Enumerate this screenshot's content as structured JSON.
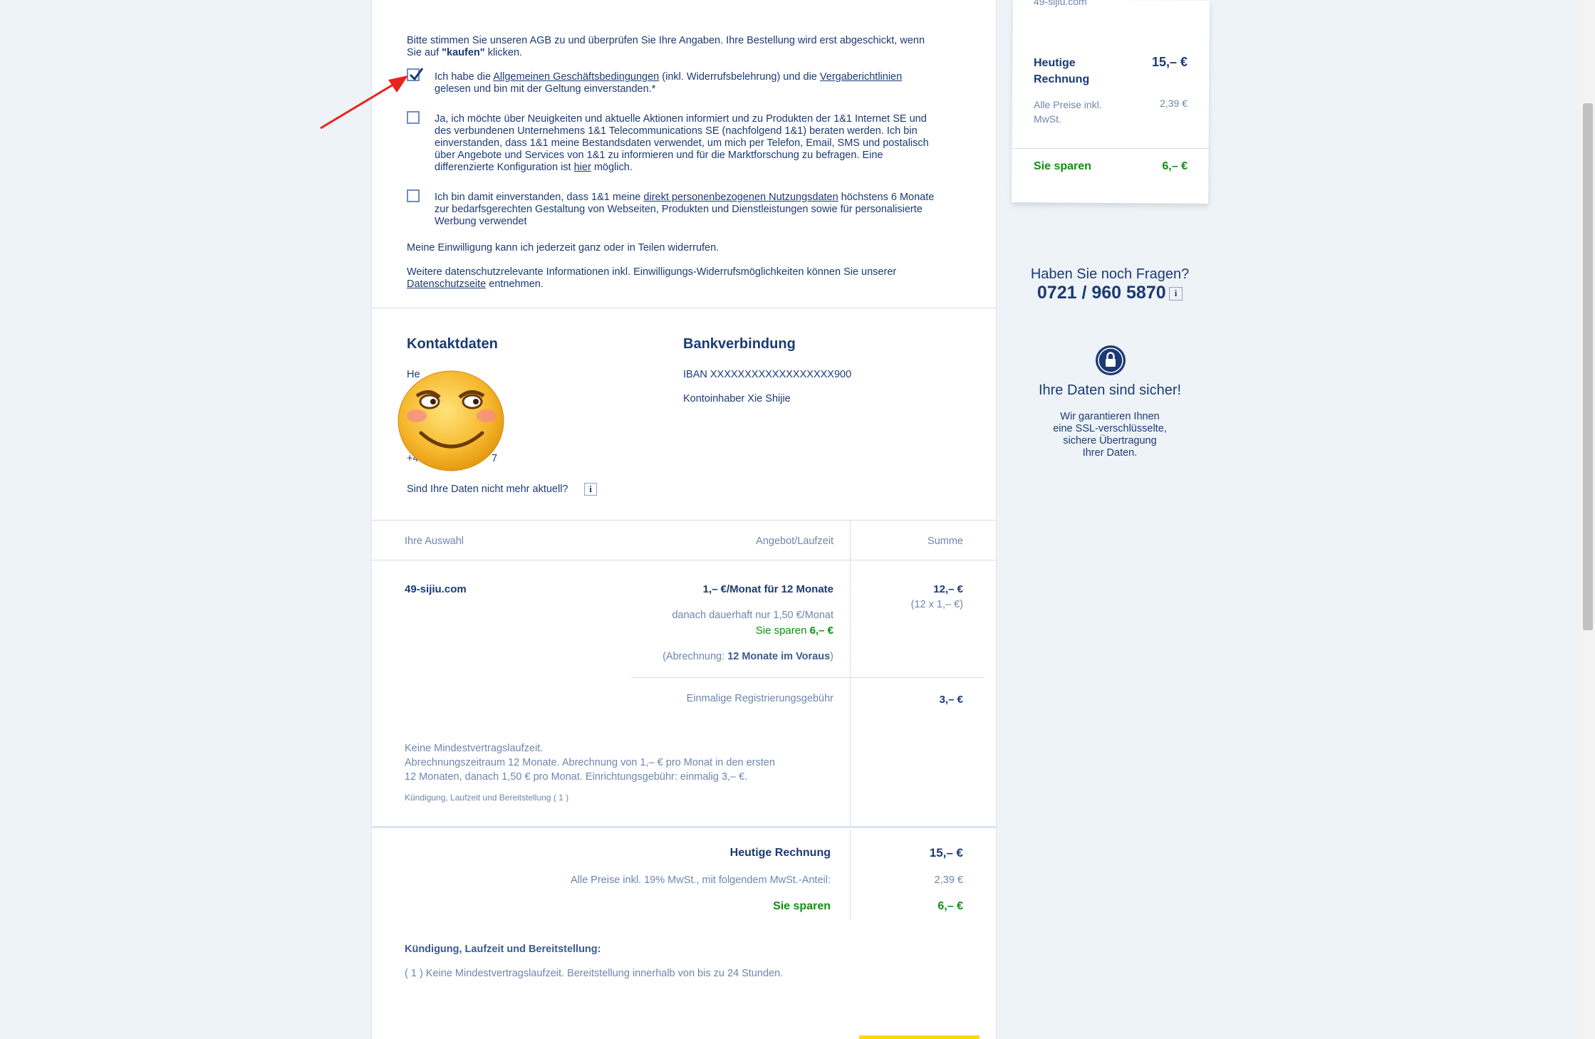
{
  "agb": {
    "intro_1": "Bitte stimmen Sie unseren AGB zu und überprüfen Sie Ihre Angaben. Ihre Bestellung wird erst abgeschickt, wenn",
    "intro_2a": "Sie auf ",
    "intro_2b": "\"kaufen\"",
    "intro_2c": " klicken.",
    "cb1": {
      "checked": true,
      "l1a": "Ich habe die ",
      "link1": "Allgemeinen Geschäftsbedingungen",
      "l1b": " (inkl. Widerrufsbelehrung) und die ",
      "link2": "Vergaberichtlinien",
      "l2": "gelesen und bin mit der Geltung einverstanden.*"
    },
    "cb2": {
      "checked": false,
      "lines": [
        "Ja, ich möchte über Neuigkeiten und aktuelle Aktionen informiert und zu Produkten der 1&1 Internet SE und",
        "des verbundenen Unternehmens 1&1 Telecommunications SE (nachfolgend 1&1) beraten werden. Ich bin",
        "einverstanden, dass 1&1 meine Bestandsdaten verwendet, um mich per Telefon, Email, SMS und postalisch",
        "über Angebote und Services von 1&1 zu informieren und für die Marktforschung zu befragen. Eine"
      ],
      "l5a": "differenzierte Konfiguration ist ",
      "l5link": "hier",
      "l5b": " möglich."
    },
    "cb3": {
      "checked": false,
      "l1a": "Ich bin damit einverstanden, dass 1&1 meine ",
      "l1link": "direkt personenbezogenen Nutzungsdaten",
      "l1b": " höchstens 6 Monate",
      "l2": "zur bedarfsgerechten Gestaltung von Webseiten, Produkten und Dienstleistungen sowie für personalisierte",
      "l3": "Werbung verwendet"
    },
    "revoke": "Meine Einwilligung kann ich jederzeit ganz oder in Teilen widerrufen.",
    "privacy_1": "Weitere datenschutzrelevante Informationen inkl. Einwilligungs-Widerrufsmöglichkeiten können Sie unserer",
    "privacy_link": "Datenschutzseite",
    "privacy_2": " entnehmen."
  },
  "contact": {
    "title": "Kontaktdaten",
    "line1": "He",
    "line2": "m",
    "line3": "+4",
    "line4": "7",
    "outdated": "Sind Ihre Daten nicht mehr aktuell?",
    "info_icon": "info-icon"
  },
  "bank": {
    "title": "Bankverbindung",
    "iban": "IBAN XXXXXXXXXXXXXXXXXX900",
    "holder": "Kontoinhaber Xie Shijie"
  },
  "table": {
    "col_selection": "Ihre Auswahl",
    "col_offer": "Angebot/Laufzeit",
    "col_sum": "Summe",
    "product": "49-sijiu.com",
    "offer_price": "1,– €/Monat für 12 Monate",
    "offer_after": "danach dauerhaft nur 1,50 €/Monat",
    "save_label": "Sie sparen ",
    "save_value": "6,– €",
    "billing_pre": "(Abrechnung: ",
    "billing_value": "12 Monate im Voraus",
    "billing_post": ")",
    "sum": "12,– €",
    "sum_detail": "(12 x 1,– €)",
    "reg_fee_label": "Einmalige Registrierungsgebühr",
    "reg_fee": "3,– €",
    "note_1": "Keine Mindestvertragslaufzeit.",
    "note_2": "Abrechnungszeitraum 12 Monate. Abrechnung von 1,– € pro Monat in den ersten",
    "note_3": "12 Monaten, danach 1,50 € pro Monat. Einrichtungsgebühr: einmalig 3,– €.",
    "note_small": "Kündigung, Laufzeit und Bereitstellung ( 1 )"
  },
  "totals": {
    "today_label": "Heutige Rechnung",
    "today_value": "15,– €",
    "vat_label": "Alle Preise inkl. 19% MwSt., mit folgendem MwSt.-Anteil:",
    "vat_value": "2,39 €",
    "save_label": "Sie sparen",
    "save_value": "6,– €"
  },
  "terms": {
    "title": "Kündigung, Laufzeit und Bereitstellung:",
    "text": "( 1 ) Keine Mindestvertragslaufzeit. Bereitstellung innerhalb von bis zu 24 Stunden."
  },
  "sidebar": {
    "domain": "49-sijiu.com",
    "today_l1": "Heutige",
    "today_l2": "Rechnung",
    "today_value": "15,– €",
    "vat_l1": "Alle Preise inkl.",
    "vat_l2": "MwSt.",
    "vat_value": "2,39 €",
    "save_label": "Sie sparen",
    "save_value": "6,– €",
    "questions": "Haben Sie noch Fragen?",
    "phone": "0721 / 960 5870",
    "secure_title": "Ihre Daten sind sicher!",
    "secure_lines": [
      "Wir garantieren Ihnen",
      "eine SSL-verschlüsselte,",
      "sichere Übertragung",
      "Ihrer Daten."
    ]
  },
  "colors": {
    "navy": "#1b3a73",
    "green": "#0f8f0f",
    "annotation_arrow": "#e8231f",
    "cta_yellow": "#ffd800"
  }
}
